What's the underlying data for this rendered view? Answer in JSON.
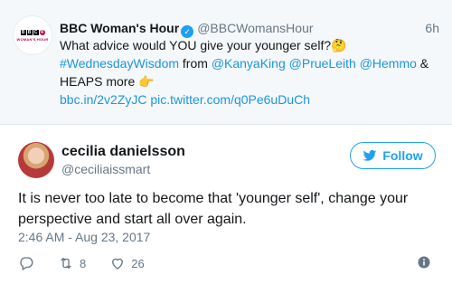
{
  "quoted": {
    "avatar_logo": "BBC 4 WOMAN'S HOUR",
    "name": "BBC Woman's Hour",
    "handle": "@BBCWomansHour",
    "time": "6h",
    "line1": "What advice would YOU give your younger self?🤔",
    "hashtag": "#WednesdayWisdom",
    "from_word": "from",
    "mention1": "@KanyaKing",
    "mention2": "@PrueLeith",
    "mention3": "@Hemmo",
    "amp": "&",
    "heaps": "HEAPS more 👉",
    "link1": "bbc.in/2v2ZyJC",
    "link2": "pic.twitter.com/q0Pe6uDuCh"
  },
  "tweet": {
    "name": "cecilia danielsson",
    "handle": "@ceciliaissmart",
    "follow_label": "Follow",
    "text": "It is never too late to become that 'younger self', change your perspective and start all over again.",
    "timestamp": "2:46 AM - Aug 23, 2017",
    "retweets": "8",
    "likes": "26"
  },
  "colors": {
    "accent": "#1da1f2",
    "link": "#1b95e0",
    "secondary_text": "#657786",
    "quoted_bg": "#f5f8fa"
  },
  "icons": [
    "verified-badge-icon",
    "twitter-bird-icon",
    "reply-icon",
    "retweet-icon",
    "heart-icon",
    "info-icon"
  ]
}
